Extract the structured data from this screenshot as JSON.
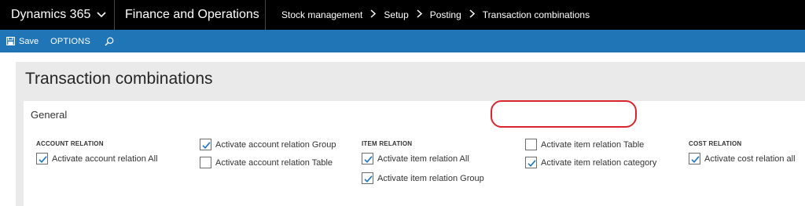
{
  "topbar": {
    "app_name": "Dynamics 365",
    "module": "Finance and Operations",
    "breadcrumb": [
      "Stock management",
      "Setup",
      "Posting",
      "Transaction combinations"
    ]
  },
  "actionbar": {
    "save_label": "Save",
    "options_label": "OPTIONS"
  },
  "page": {
    "title": "Transaction combinations"
  },
  "general": {
    "title": "General",
    "account_relation": {
      "header": "ACCOUNT RELATION",
      "all": {
        "label": "Activate account relation All",
        "checked": true
      },
      "group": {
        "label": "Activate account relation Group",
        "checked": true
      },
      "table": {
        "label": "Activate account relation Table",
        "checked": false
      }
    },
    "item_relation": {
      "header": "ITEM RELATION",
      "all": {
        "label": "Activate item relation All",
        "checked": true
      },
      "group": {
        "label": "Activate item relation Group",
        "checked": true
      },
      "table": {
        "label": "Activate item relation Table",
        "checked": false
      },
      "category": {
        "label": "Activate item relation category",
        "checked": true
      }
    },
    "cost_relation": {
      "header": "COST RELATION",
      "all": {
        "label": "Activate cost relation all",
        "checked": true
      }
    }
  },
  "icons": {
    "dropdown": "chevron-down-icon",
    "breadcrumb_separator": "chevron-right-icon",
    "save": "save-icon",
    "search": "search-icon",
    "checkmark": "checkmark-icon"
  },
  "colors": {
    "topbar": "#000000",
    "actionbar": "#1f75b5",
    "page_background": "#eaeaea",
    "checkmark": "#1f75b5",
    "annotation": "#d9262c"
  }
}
